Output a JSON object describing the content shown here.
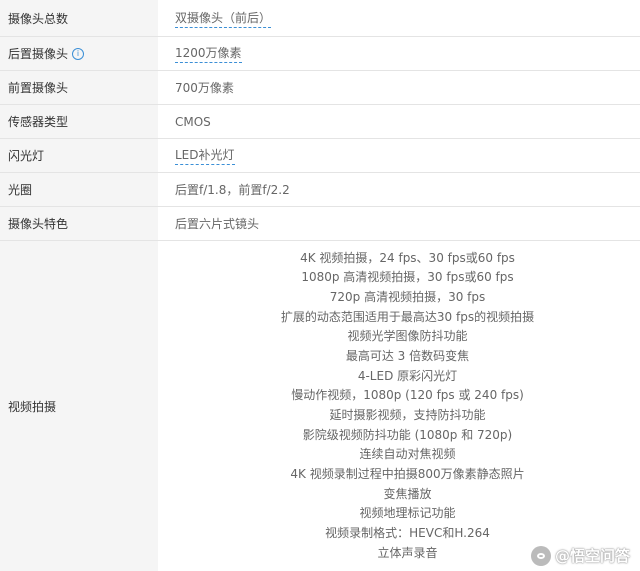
{
  "rows": [
    {
      "label": "摄像头总数",
      "value": "双摄像头（前后）"
    },
    {
      "label": "后置摄像头",
      "value": "1200万像素"
    },
    {
      "label": "前置摄像头",
      "value": "700万像素"
    },
    {
      "label": "传感器类型",
      "value": "CMOS"
    },
    {
      "label": "闪光灯",
      "value": "LED补光灯"
    },
    {
      "label": "光圈",
      "value": "后置f/1.8，前置f/2.2"
    },
    {
      "label": "摄像头特色",
      "value": "后置六片式镜头"
    }
  ],
  "video": {
    "label": "视频拍摄",
    "lines": [
      "4K 视频拍摄，24 fps、30 fps或60 fps",
      "1080p 高清视频拍摄，30 fps或60 fps",
      "720p 高清视频拍摄，30 fps",
      "扩展的动态范围适用于最高达30 fps的视频拍摄",
      "视频光学图像防抖功能",
      "最高可达 3 倍数码变焦",
      "4-LED 原彩闪光灯",
      "慢动作视频，1080p (120 fps 或 240 fps)",
      "延时摄影视频，支持防抖功能",
      "影院级视频防抖功能 (1080p 和 720p)",
      "连续自动对焦视频",
      "4K 视频录制过程中拍摄800万像素静态照片",
      "变焦播放",
      "视频地理标记功能",
      "视频录制格式：HEVC和H.264",
      "立体声录音"
    ]
  },
  "info_icon": {
    "glyph": "i",
    "icon": "info-icon",
    "color": "#3b8fd6"
  },
  "watermark": {
    "text": "@悟空问答"
  }
}
